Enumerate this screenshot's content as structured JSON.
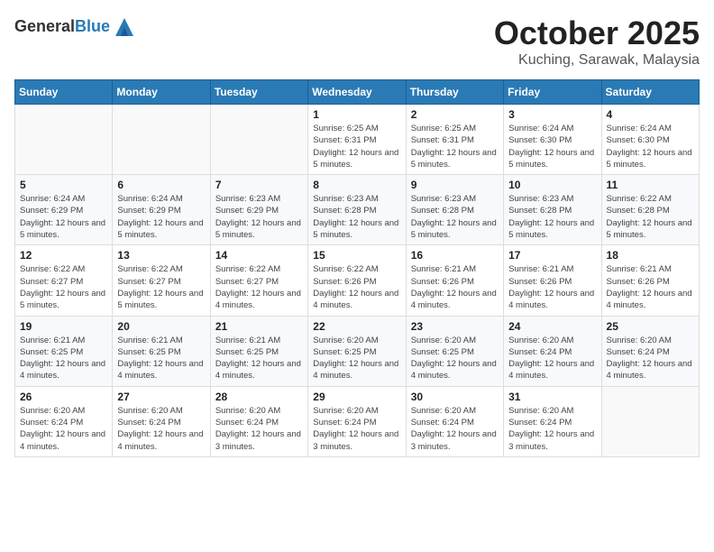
{
  "header": {
    "logo_line1": "General",
    "logo_line2": "Blue",
    "month": "October 2025",
    "location": "Kuching, Sarawak, Malaysia"
  },
  "days_of_week": [
    "Sunday",
    "Monday",
    "Tuesday",
    "Wednesday",
    "Thursday",
    "Friday",
    "Saturday"
  ],
  "weeks": [
    [
      {
        "day": "",
        "info": ""
      },
      {
        "day": "",
        "info": ""
      },
      {
        "day": "",
        "info": ""
      },
      {
        "day": "1",
        "info": "Sunrise: 6:25 AM\nSunset: 6:31 PM\nDaylight: 12 hours and 5 minutes."
      },
      {
        "day": "2",
        "info": "Sunrise: 6:25 AM\nSunset: 6:31 PM\nDaylight: 12 hours and 5 minutes."
      },
      {
        "day": "3",
        "info": "Sunrise: 6:24 AM\nSunset: 6:30 PM\nDaylight: 12 hours and 5 minutes."
      },
      {
        "day": "4",
        "info": "Sunrise: 6:24 AM\nSunset: 6:30 PM\nDaylight: 12 hours and 5 minutes."
      }
    ],
    [
      {
        "day": "5",
        "info": "Sunrise: 6:24 AM\nSunset: 6:29 PM\nDaylight: 12 hours and 5 minutes."
      },
      {
        "day": "6",
        "info": "Sunrise: 6:24 AM\nSunset: 6:29 PM\nDaylight: 12 hours and 5 minutes."
      },
      {
        "day": "7",
        "info": "Sunrise: 6:23 AM\nSunset: 6:29 PM\nDaylight: 12 hours and 5 minutes."
      },
      {
        "day": "8",
        "info": "Sunrise: 6:23 AM\nSunset: 6:28 PM\nDaylight: 12 hours and 5 minutes."
      },
      {
        "day": "9",
        "info": "Sunrise: 6:23 AM\nSunset: 6:28 PM\nDaylight: 12 hours and 5 minutes."
      },
      {
        "day": "10",
        "info": "Sunrise: 6:23 AM\nSunset: 6:28 PM\nDaylight: 12 hours and 5 minutes."
      },
      {
        "day": "11",
        "info": "Sunrise: 6:22 AM\nSunset: 6:28 PM\nDaylight: 12 hours and 5 minutes."
      }
    ],
    [
      {
        "day": "12",
        "info": "Sunrise: 6:22 AM\nSunset: 6:27 PM\nDaylight: 12 hours and 5 minutes."
      },
      {
        "day": "13",
        "info": "Sunrise: 6:22 AM\nSunset: 6:27 PM\nDaylight: 12 hours and 5 minutes."
      },
      {
        "day": "14",
        "info": "Sunrise: 6:22 AM\nSunset: 6:27 PM\nDaylight: 12 hours and 4 minutes."
      },
      {
        "day": "15",
        "info": "Sunrise: 6:22 AM\nSunset: 6:26 PM\nDaylight: 12 hours and 4 minutes."
      },
      {
        "day": "16",
        "info": "Sunrise: 6:21 AM\nSunset: 6:26 PM\nDaylight: 12 hours and 4 minutes."
      },
      {
        "day": "17",
        "info": "Sunrise: 6:21 AM\nSunset: 6:26 PM\nDaylight: 12 hours and 4 minutes."
      },
      {
        "day": "18",
        "info": "Sunrise: 6:21 AM\nSunset: 6:26 PM\nDaylight: 12 hours and 4 minutes."
      }
    ],
    [
      {
        "day": "19",
        "info": "Sunrise: 6:21 AM\nSunset: 6:25 PM\nDaylight: 12 hours and 4 minutes."
      },
      {
        "day": "20",
        "info": "Sunrise: 6:21 AM\nSunset: 6:25 PM\nDaylight: 12 hours and 4 minutes."
      },
      {
        "day": "21",
        "info": "Sunrise: 6:21 AM\nSunset: 6:25 PM\nDaylight: 12 hours and 4 minutes."
      },
      {
        "day": "22",
        "info": "Sunrise: 6:20 AM\nSunset: 6:25 PM\nDaylight: 12 hours and 4 minutes."
      },
      {
        "day": "23",
        "info": "Sunrise: 6:20 AM\nSunset: 6:25 PM\nDaylight: 12 hours and 4 minutes."
      },
      {
        "day": "24",
        "info": "Sunrise: 6:20 AM\nSunset: 6:24 PM\nDaylight: 12 hours and 4 minutes."
      },
      {
        "day": "25",
        "info": "Sunrise: 6:20 AM\nSunset: 6:24 PM\nDaylight: 12 hours and 4 minutes."
      }
    ],
    [
      {
        "day": "26",
        "info": "Sunrise: 6:20 AM\nSunset: 6:24 PM\nDaylight: 12 hours and 4 minutes."
      },
      {
        "day": "27",
        "info": "Sunrise: 6:20 AM\nSunset: 6:24 PM\nDaylight: 12 hours and 4 minutes."
      },
      {
        "day": "28",
        "info": "Sunrise: 6:20 AM\nSunset: 6:24 PM\nDaylight: 12 hours and 3 minutes."
      },
      {
        "day": "29",
        "info": "Sunrise: 6:20 AM\nSunset: 6:24 PM\nDaylight: 12 hours and 3 minutes."
      },
      {
        "day": "30",
        "info": "Sunrise: 6:20 AM\nSunset: 6:24 PM\nDaylight: 12 hours and 3 minutes."
      },
      {
        "day": "31",
        "info": "Sunrise: 6:20 AM\nSunset: 6:24 PM\nDaylight: 12 hours and 3 minutes."
      },
      {
        "day": "",
        "info": ""
      }
    ]
  ]
}
